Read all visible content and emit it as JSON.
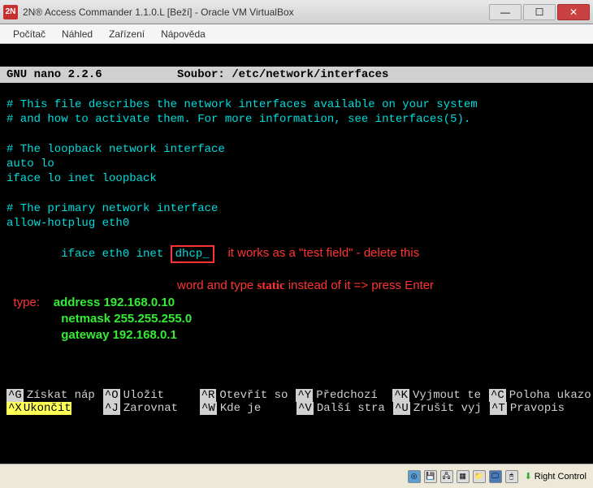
{
  "window": {
    "icon_text": "2N",
    "title": "2N® Access Commander 1.1.0.L [Beží] - Oracle VM VirtualBox"
  },
  "menu": {
    "items": [
      "Počítač",
      "Náhled",
      "Zařízení",
      "Nápověda"
    ]
  },
  "nano": {
    "header_left": "GNU nano 2.2.6",
    "header_file_label": "Soubor:",
    "header_file": "/etc/network/interfaces"
  },
  "file_content": {
    "c1": "# This file describes the network interfaces available on your system",
    "c2": "# and how to activate them. For more information, see interfaces(5).",
    "c3": "# The loopback network interface",
    "l1": "auto lo",
    "l2": "iface lo inet loopback",
    "c4": "# The primary network interface",
    "l3": "allow-hotplug eth0",
    "l4_pre": "iface eth0 inet ",
    "l4_dhcp": "dhcp_"
  },
  "annotations": {
    "a1": "it works as a \"test field\" - delete this",
    "a2_pre": "word and type ",
    "a2_static": "static",
    "a2_post": " instead of it => press Enter",
    "type_label": "type:",
    "addr": "address 192.168.0.10",
    "mask": "netmask 255.255.255.0",
    "gw": "gateway 192.168.0.1"
  },
  "shortcuts": {
    "row1": [
      {
        "key": "^G",
        "label": "Získat náp",
        "hl": false
      },
      {
        "key": "^O",
        "label": "Uložit",
        "hl": false
      },
      {
        "key": "^R",
        "label": "Otevřít so",
        "hl": false
      },
      {
        "key": "^Y",
        "label": "Předchozí",
        "hl": false
      },
      {
        "key": "^K",
        "label": "Vyjmout te",
        "hl": false
      },
      {
        "key": "^C",
        "label": "Poloha ukazo",
        "hl": false
      }
    ],
    "row2": [
      {
        "key": "^X",
        "label": "Ukončit",
        "hl": true
      },
      {
        "key": "^J",
        "label": "Zarovnat",
        "hl": false
      },
      {
        "key": "^W",
        "label": "Kde je",
        "hl": false
      },
      {
        "key": "^V",
        "label": "Další stra",
        "hl": false
      },
      {
        "key": "^U",
        "label": "Zrušit vyj",
        "hl": false
      },
      {
        "key": "^T",
        "label": "Pravopis",
        "hl": false
      }
    ]
  },
  "statusbar": {
    "label": "Right Control"
  }
}
